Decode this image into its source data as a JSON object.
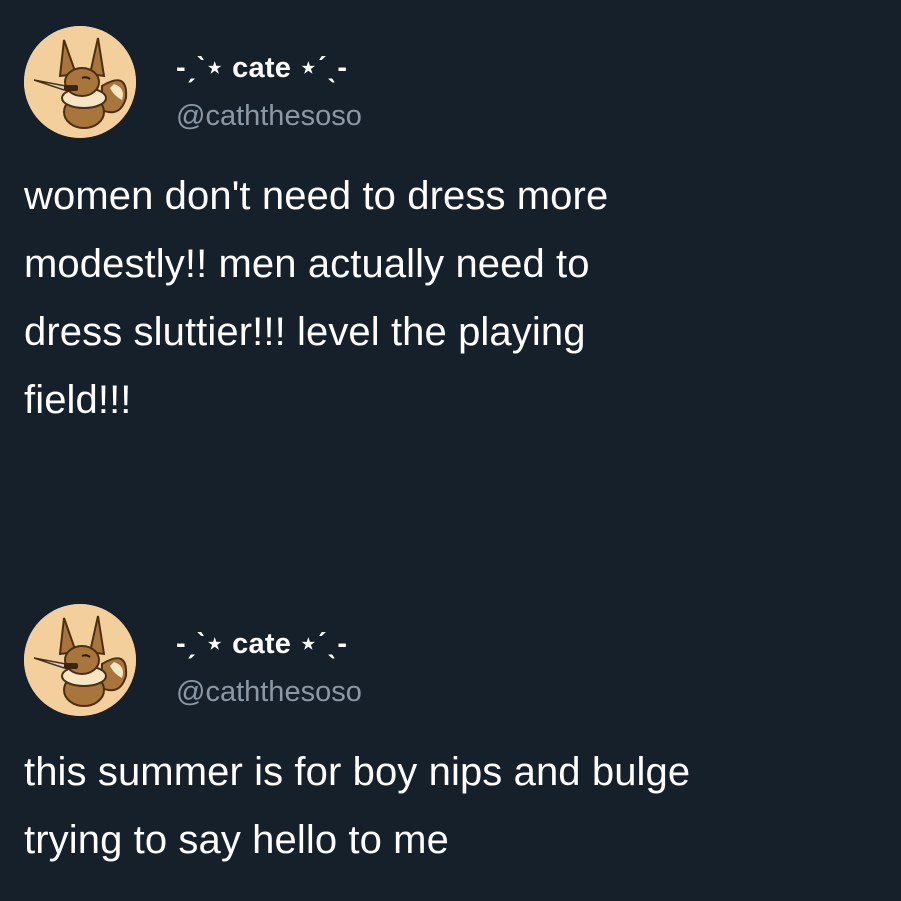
{
  "tweets": [
    {
      "display_name": "-ˏˋ⋆ cate ⋆ˊˎ-",
      "handle": "@caththesoso",
      "text": "women don't need to dress more\nmodestly!! men actually need to\ndress sluttier!!! level the playing\nfield!!!",
      "avatar": "eevee-with-knife-avatar"
    },
    {
      "display_name": "-ˏˋ⋆ cate ⋆ˊˎ-",
      "handle": "@caththesoso",
      "text": "this summer is for boy nips and bulge\ntrying to say hello to me",
      "avatar": "eevee-with-knife-avatar"
    }
  ],
  "colors": {
    "background": "#15202b",
    "text": "#ffffff",
    "handle": "#8b98a5",
    "avatar_bg": "#f3cf9b"
  }
}
